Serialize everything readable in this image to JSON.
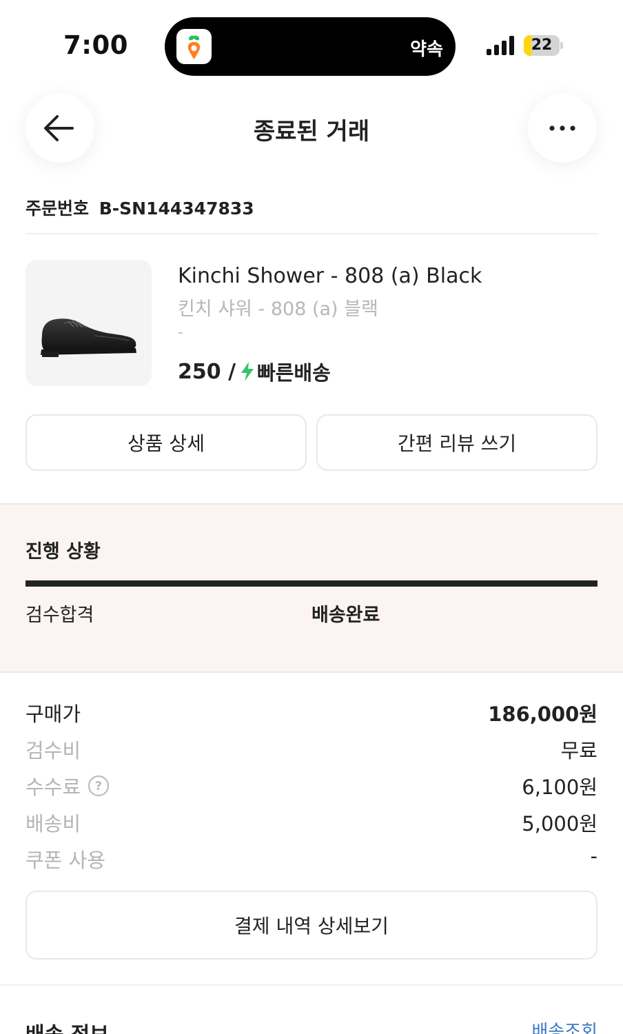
{
  "status_bar": {
    "time": "7:00",
    "island_label": "약속",
    "island_app_icon": "carrot-app-icon",
    "battery_percent": 22,
    "battery_label": "22",
    "signal_bars": 4
  },
  "header": {
    "title": "종료된 거래",
    "back_icon": "back-arrow-icon",
    "more_icon": "more-dots-icon"
  },
  "order": {
    "label": "주문번호",
    "number": "B-SN144347833"
  },
  "product": {
    "name": "Kinchi Shower - 808 (a) Black",
    "name_ko": "킨치 샤워 - 808 (a) 블랙",
    "option": "-",
    "size": "250 /",
    "delivery_type": "빠른배송",
    "image_icon": "black-shoe-image",
    "accent_color": "#36c46b"
  },
  "actions": {
    "detail_label": "상품 상세",
    "review_label": "간편 리뷰 쓰기"
  },
  "progress": {
    "title": "진행 상황",
    "steps": [
      "검수합격",
      "배송완료"
    ],
    "current_step": 2,
    "completion": 1.0
  },
  "prices": {
    "purchase": {
      "label": "구매가",
      "value": "186,000원"
    },
    "inspection": {
      "label": "검수비",
      "value": "무료"
    },
    "fee": {
      "label": "수수료",
      "value": "6,100원"
    },
    "shipping": {
      "label": "배송비",
      "value": "5,000원"
    },
    "coupon": {
      "label": "쿠폰 사용",
      "value": "-"
    }
  },
  "payment_button_label": "결제 내역 상세보기",
  "shipping_info": {
    "title": "배송 정보",
    "track_link": "배송조회",
    "link_color": "#3a79c7"
  }
}
